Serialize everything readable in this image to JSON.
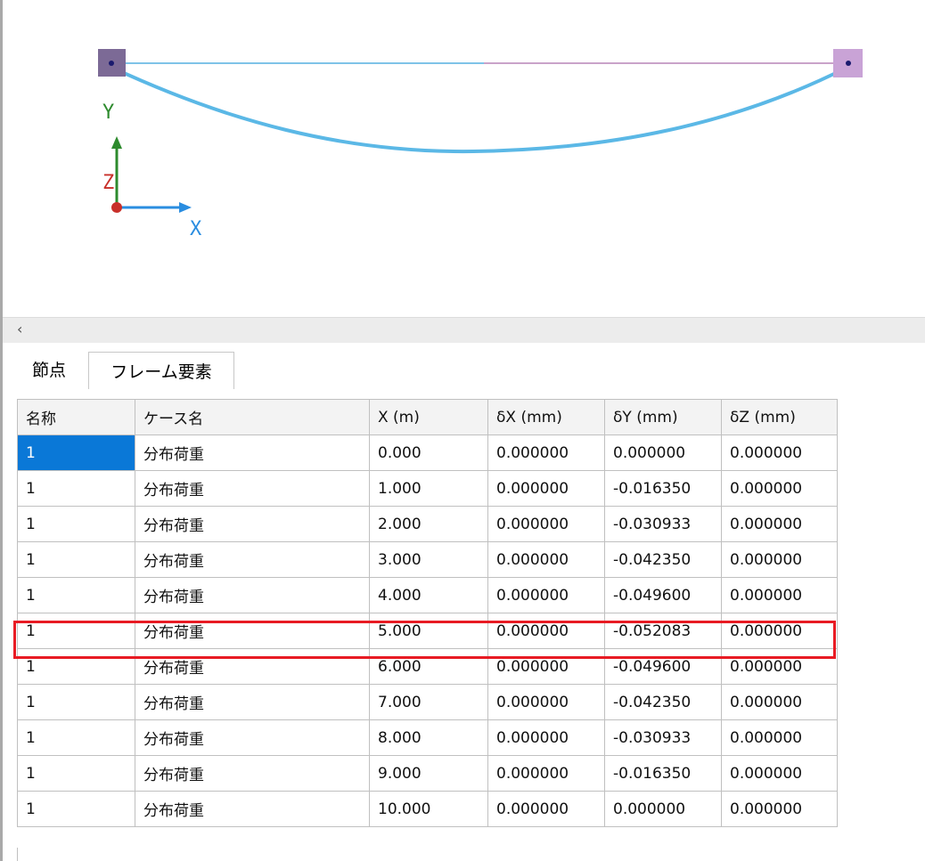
{
  "viewport": {
    "axis_labels": {
      "y": "Y",
      "z": "Z",
      "x": "X"
    },
    "colors": {
      "deflected_curve": "#5bb8e6",
      "member_left": "#7ec3e8",
      "member_right": "#c9a3c9",
      "node_left": "#7c6a96",
      "node_right": "#c9a3d6",
      "node_dot": "#1a1a6e",
      "axis_y": "#2e8b2e",
      "axis_x": "#2a8de0",
      "axis_z": "#c8302a"
    }
  },
  "scrollbar": {
    "left_arrow": "‹"
  },
  "tabs": [
    {
      "label": "節点",
      "active": false
    },
    {
      "label": "フレーム要素",
      "active": true
    }
  ],
  "table": {
    "headers": [
      "名称",
      "ケース名",
      "X (m)",
      "δX (mm)",
      "δY (mm)",
      "δZ (mm)"
    ],
    "rows": [
      [
        "1",
        "分布荷重",
        "0.000",
        "0.000000",
        "0.000000",
        "0.000000"
      ],
      [
        "1",
        "分布荷重",
        "1.000",
        "0.000000",
        "-0.016350",
        "0.000000"
      ],
      [
        "1",
        "分布荷重",
        "2.000",
        "0.000000",
        "-0.030933",
        "0.000000"
      ],
      [
        "1",
        "分布荷重",
        "3.000",
        "0.000000",
        "-0.042350",
        "0.000000"
      ],
      [
        "1",
        "分布荷重",
        "4.000",
        "0.000000",
        "-0.049600",
        "0.000000"
      ],
      [
        "1",
        "分布荷重",
        "5.000",
        "0.000000",
        "-0.052083",
        "0.000000"
      ],
      [
        "1",
        "分布荷重",
        "6.000",
        "0.000000",
        "-0.049600",
        "0.000000"
      ],
      [
        "1",
        "分布荷重",
        "7.000",
        "0.000000",
        "-0.042350",
        "0.000000"
      ],
      [
        "1",
        "分布荷重",
        "8.000",
        "0.000000",
        "-0.030933",
        "0.000000"
      ],
      [
        "1",
        "分布荷重",
        "9.000",
        "0.000000",
        "-0.016350",
        "0.000000"
      ],
      [
        "1",
        "分布荷重",
        "10.000",
        "0.000000",
        "0.000000",
        "0.000000"
      ]
    ],
    "selected_cell": {
      "row": 0,
      "col": 0
    },
    "highlighted_row": 5,
    "highlight_color": "#e81b23",
    "selection_color": "#0a78d7"
  }
}
